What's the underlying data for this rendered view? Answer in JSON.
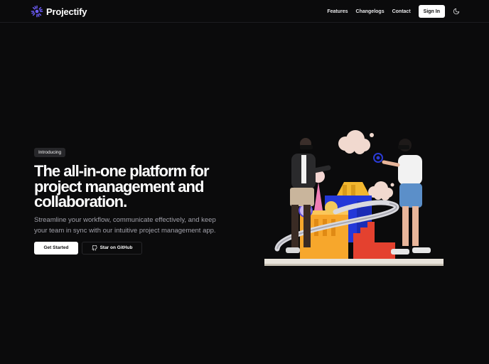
{
  "app": {
    "name": "Projectify"
  },
  "nav": {
    "links": [
      "Features",
      "Changelogs",
      "Contact"
    ],
    "signin_label": "Sign In",
    "theme_icon": "moon-icon"
  },
  "hero": {
    "badge": "Introducing",
    "headline": "The all-in-one platform for project management and collaboration.",
    "subtext": "Streamline your workflow, communicate effectively, and keep your team in sync with our intuitive project management app.",
    "primary_cta": "Get Started",
    "secondary_cta": "Star on GitHub",
    "secondary_icon": "github-icon"
  },
  "colors": {
    "background": "#0b0b0c",
    "accent": "#6d5dfc",
    "button_bg": "#ffffff"
  }
}
